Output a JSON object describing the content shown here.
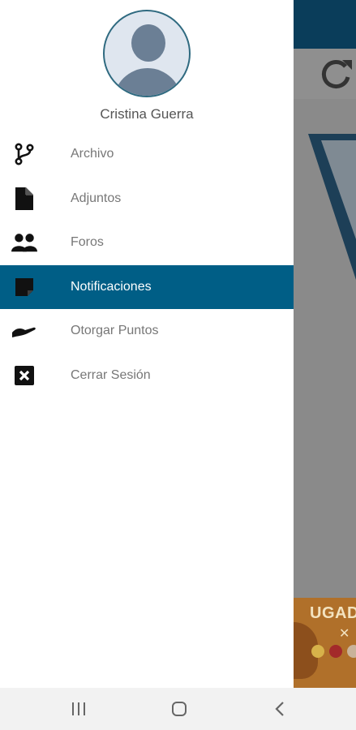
{
  "user": {
    "name": "Cristina Guerra"
  },
  "menu": {
    "items": [
      {
        "label": "Archivo",
        "icon": "source-branch-icon",
        "active": false
      },
      {
        "label": "Adjuntos",
        "icon": "file-icon",
        "active": false
      },
      {
        "label": "Foros",
        "icon": "users-icon",
        "active": false
      },
      {
        "label": "Notificaciones",
        "icon": "sticky-note-icon",
        "active": true
      },
      {
        "label": "Otorgar Puntos",
        "icon": "hand-giving-icon",
        "active": false
      },
      {
        "label": "Cerrar Sesión",
        "icon": "close-box-icon",
        "active": false
      }
    ]
  },
  "background_app": {
    "banner_text": "UGADA"
  },
  "colors": {
    "accent": "#005e86",
    "topbar": "#0a3d5a",
    "avatar_border": "#2f6a80"
  },
  "navbar": {
    "items": [
      "recent-apps-icon",
      "home-icon",
      "back-icon"
    ]
  }
}
